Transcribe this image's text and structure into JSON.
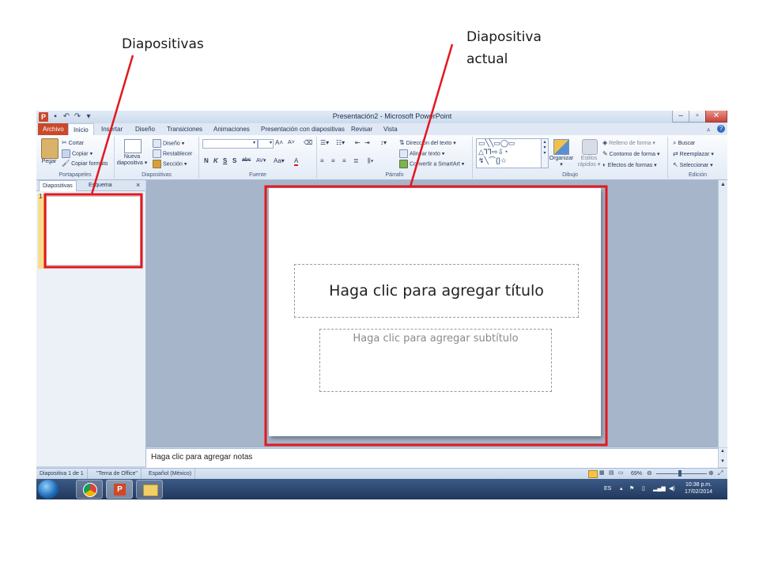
{
  "annotations": {
    "left_label": "Diapositivas",
    "right_label_line1": "Diapositiva",
    "right_label_line2": "actual",
    "highlight_color": "#e3171e"
  },
  "window": {
    "title": "Presentación2 - Microsoft PowerPoint",
    "app_icon_letter": "P"
  },
  "tabs": [
    "Archivo",
    "Inicio",
    "Insertar",
    "Diseño",
    "Transiciones",
    "Animaciones",
    "Presentación con diapositivas",
    "Revisar",
    "Vista"
  ],
  "ribbon": {
    "portapapeles": {
      "label": "Portapapeles",
      "pegar": "Pegar",
      "cortar": "Cortar",
      "copiar": "Copiar",
      "copiar_formato": "Copiar formato"
    },
    "diapositivas": {
      "label": "Diapositivas",
      "nueva_line1": "Nueva",
      "nueva_line2": "diapositiva",
      "diseno": "Diseño",
      "restablecer": "Restablecer",
      "seccion": "Sección"
    },
    "fuente": {
      "label": "Fuente",
      "bold": "N",
      "italic": "K",
      "underline": "S",
      "shadow": "S",
      "strike": "abc",
      "spacing": "AV",
      "case": "Aa",
      "color": "A"
    },
    "parrafo": {
      "label": "Párrafo",
      "direccion": "Dirección del texto",
      "alinear": "Alinear texto",
      "convertir": "Convertir a SmartArt"
    },
    "dibujo": {
      "label": "Dibujo",
      "organizar": "Organizar",
      "estilos_line1": "Estilos",
      "estilos_line2": "rápidos",
      "relleno": "Relleno de forma",
      "contorno": "Contorno de forma",
      "efectos": "Efectos de formas"
    },
    "edicion": {
      "label": "Edición",
      "buscar": "Buscar",
      "reemplazar": "Reemplazar",
      "seleccionar": "Seleccionar"
    }
  },
  "panel": {
    "tab_slides": "Diapositivas",
    "tab_outline": "Esquema",
    "close": "×",
    "slide_number": "1"
  },
  "slide": {
    "title_placeholder": "Haga clic para agregar título",
    "subtitle_placeholder": "Haga clic para agregar subtítulo"
  },
  "notes": {
    "placeholder": "Haga clic para agregar notas"
  },
  "status": {
    "slide_count": "Diapositiva 1 de 1",
    "theme": "\"Tema de Office\"",
    "language": "Español (México)",
    "zoom": "69%"
  },
  "taskbar": {
    "lang": "ES",
    "time": "10:38 p.m.",
    "date": "17/02/2014"
  }
}
